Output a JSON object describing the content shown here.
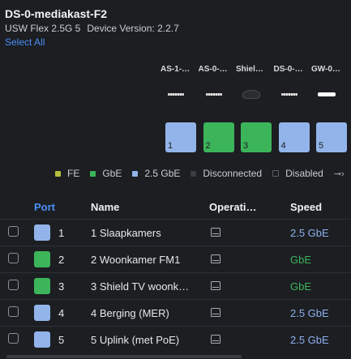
{
  "device": {
    "title": "DS-0-mediakast-F2",
    "model": "USW Flex 2.5G 5",
    "version": "Device Version: 2.2.7",
    "select_all": "Select All"
  },
  "port_panel": [
    {
      "label": "AS-1-…",
      "num": "1",
      "connector": "rj45",
      "color": "#92b4ea"
    },
    {
      "label": "AS-0-…",
      "num": "2",
      "connector": "rj45",
      "color": "#3cb55a"
    },
    {
      "label": "Shiel…",
      "num": "3",
      "connector": "dark",
      "color": "#3cb55a"
    },
    {
      "label": "DS-0-…",
      "num": "4",
      "connector": "rj45",
      "color": "#92b4ea"
    },
    {
      "label": "GW-0…",
      "num": "5",
      "connector": "white",
      "color": "#92b4ea"
    }
  ],
  "legend": {
    "fe": "FE",
    "fe_color": "#b9bf3b",
    "gbe": "GbE",
    "gbe_color": "#3cb55a",
    "g25": "2.5 GbE",
    "g25_color": "#92b4ea",
    "disconnected": "Disconnected",
    "disconnected_color": "#3a3d42",
    "disabled": "Disabled"
  },
  "table": {
    "headers": {
      "port": "Port",
      "name": "Name",
      "operation": "Operati…",
      "speed": "Speed"
    },
    "rows": [
      {
        "num": "1",
        "name": "1 Slaapkamers",
        "speed": "2.5 GbE",
        "color": "#92b4ea",
        "speed_color": "#8cb0ee"
      },
      {
        "num": "2",
        "name": "2 Woonkamer FM1",
        "speed": "GbE",
        "color": "#3cb55a",
        "speed_color": "#3cb55a"
      },
      {
        "num": "3",
        "name": "3 Shield TV woonk…",
        "speed": "GbE",
        "color": "#3cb55a",
        "speed_color": "#3cb55a"
      },
      {
        "num": "4",
        "name": "4 Berging (MER)",
        "speed": "2.5 GbE",
        "color": "#92b4ea",
        "speed_color": "#8cb0ee"
      },
      {
        "num": "5",
        "name": "5 Uplink (met PoE)",
        "speed": "2.5 GbE",
        "color": "#92b4ea",
        "speed_color": "#8cb0ee"
      }
    ]
  }
}
